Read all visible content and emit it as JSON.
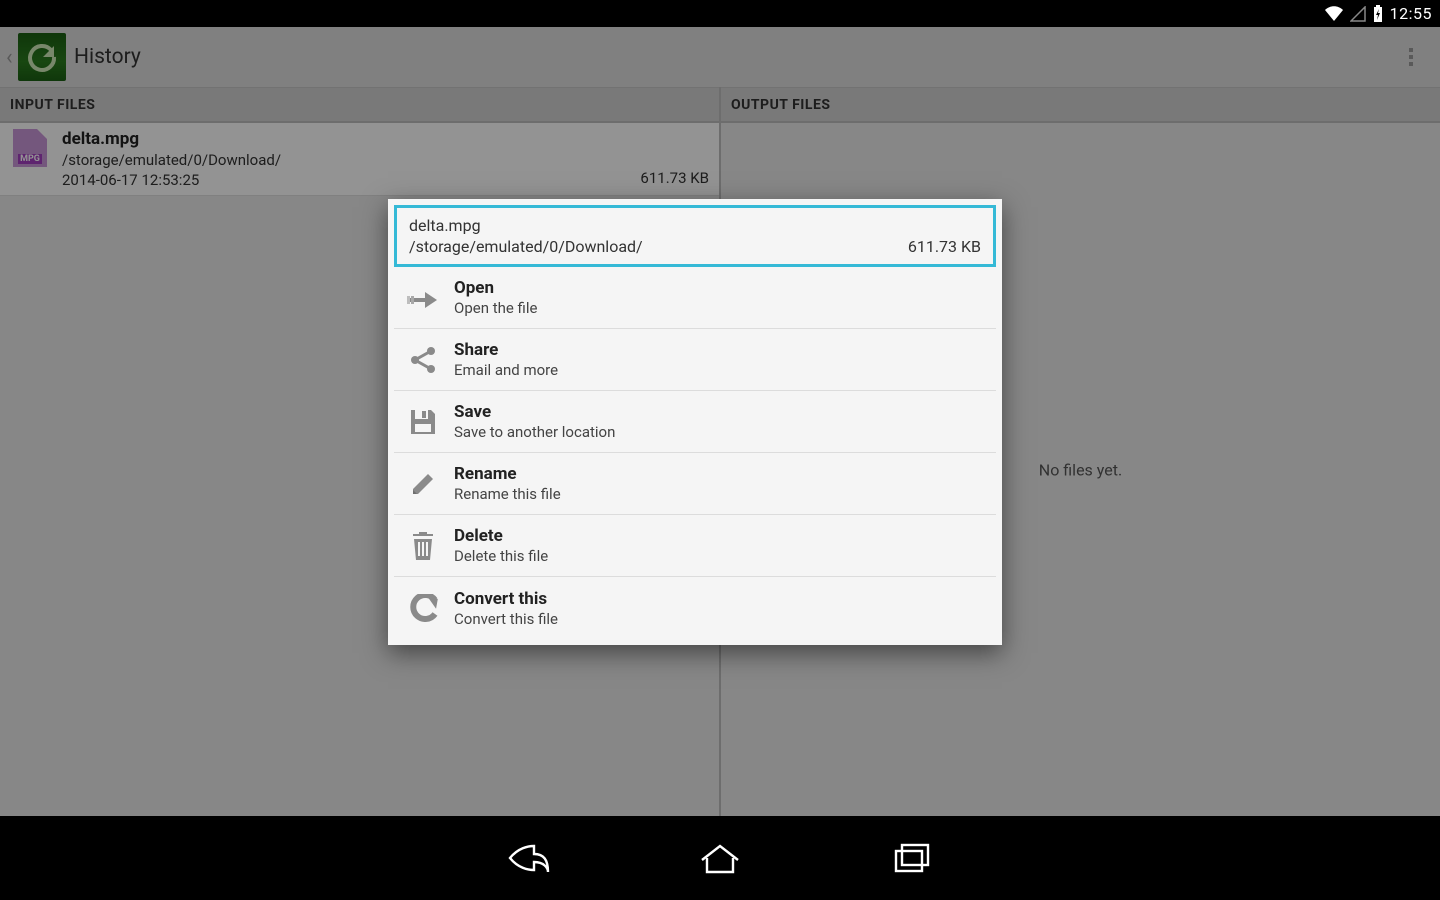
{
  "statusbar": {
    "time": "12:55"
  },
  "actionbar": {
    "title": "History"
  },
  "columns": {
    "input_header": "INPUT FILES",
    "output_header": "OUTPUT FILES",
    "output_empty": "No files yet."
  },
  "file": {
    "name": "delta.mpg",
    "path": "/storage/emulated/0/Download/",
    "date": "2014-06-17 12:53:25",
    "size": "611.73 KB",
    "type_badge": "MPG"
  },
  "dialog": {
    "name": "delta.mpg",
    "path": "/storage/emulated/0/Download/",
    "size": "611.73 KB",
    "items": [
      {
        "title": "Open",
        "sub": "Open the file"
      },
      {
        "title": "Share",
        "sub": "Email and more"
      },
      {
        "title": "Save",
        "sub": "Save to another location"
      },
      {
        "title": "Rename",
        "sub": "Rename this file"
      },
      {
        "title": "Delete",
        "sub": "Delete this file"
      },
      {
        "title": "Convert this",
        "sub": "Convert this file"
      }
    ]
  }
}
